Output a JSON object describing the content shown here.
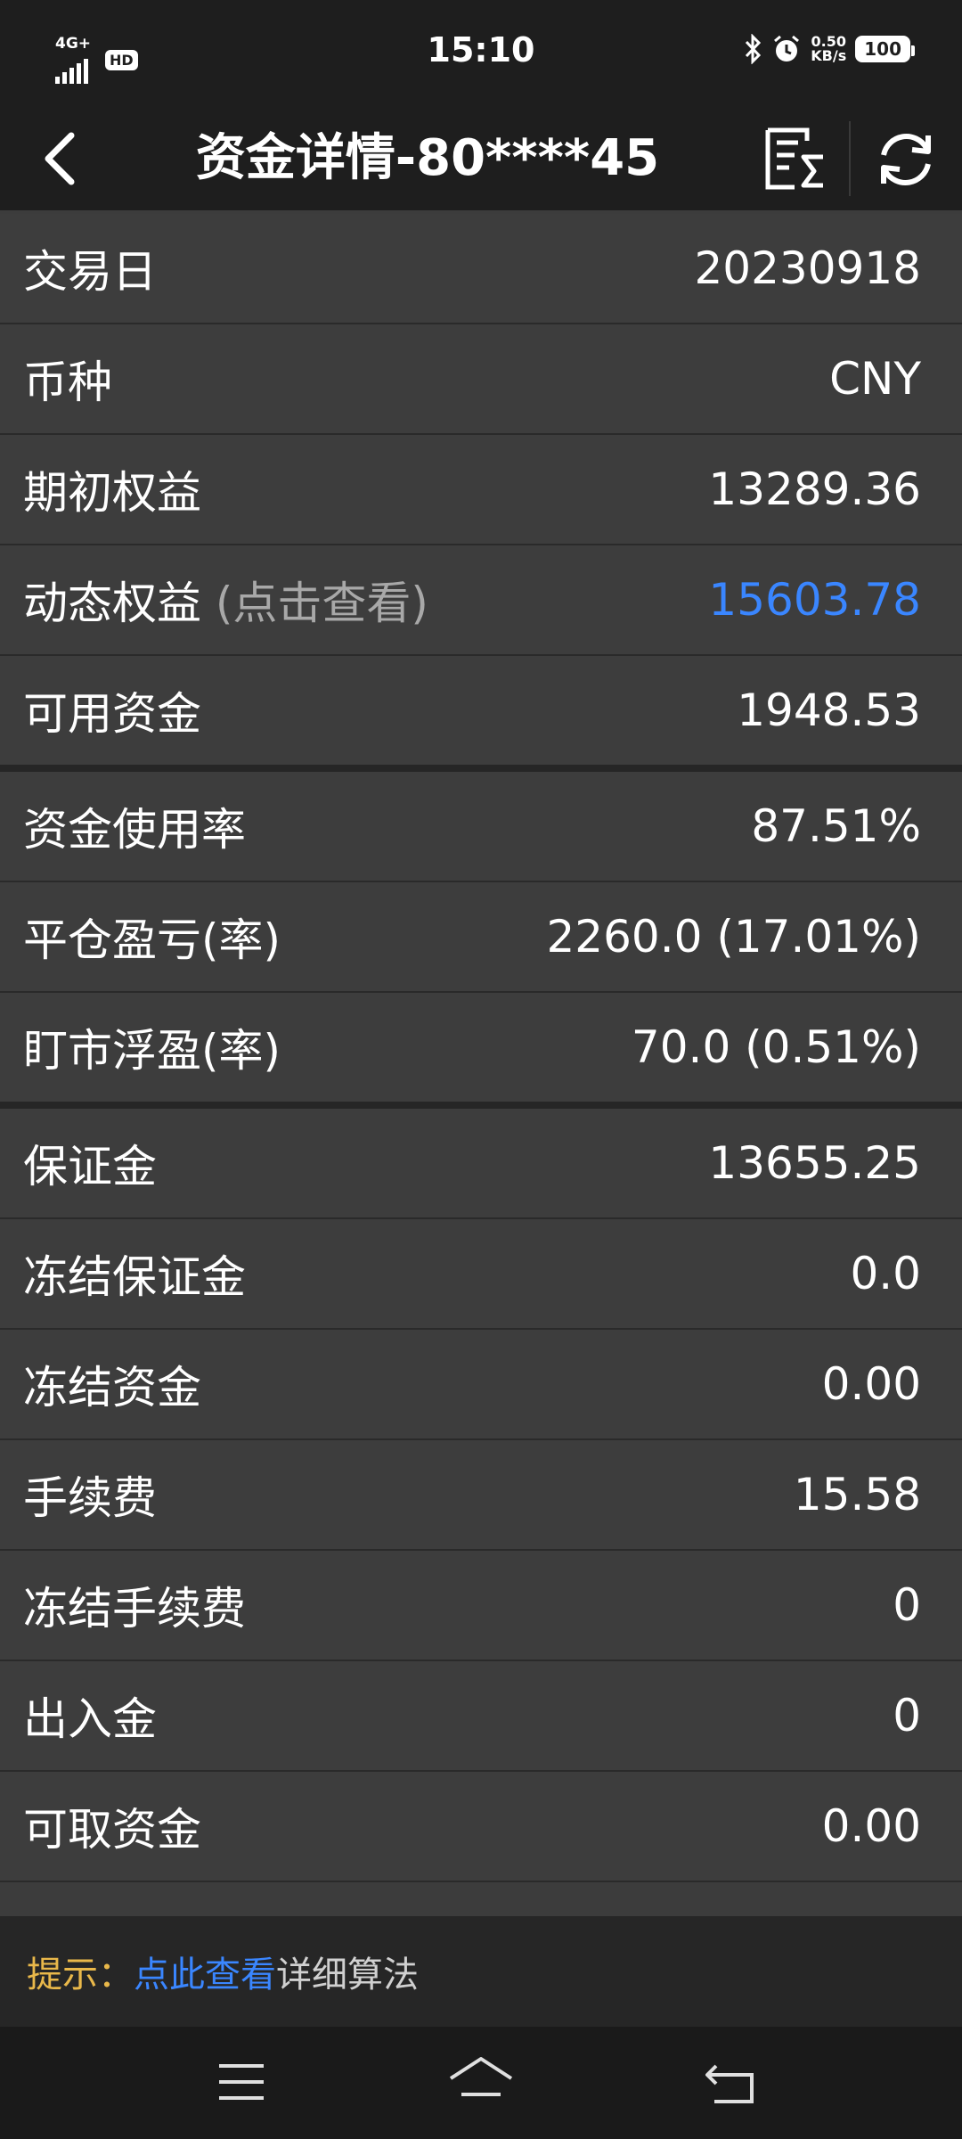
{
  "status_bar": {
    "network": "4G+",
    "hd": "HD",
    "time": "15:10",
    "speed_value": "0.50",
    "speed_unit": "KB/s",
    "battery": "100",
    "icons": [
      "signal-icon",
      "bluetooth-icon",
      "alarm-icon",
      "battery-icon"
    ]
  },
  "header": {
    "title": "资金详情-80****45",
    "icons": [
      "back-icon",
      "calculator-icon",
      "refresh-icon"
    ]
  },
  "rows": [
    {
      "label": "交易日",
      "value": "20230918"
    },
    {
      "label": "币种",
      "value": "CNY"
    },
    {
      "label": "期初权益",
      "value": "13289.36"
    },
    {
      "label": "动态权益",
      "hint": "(点击查看)",
      "value": "15603.78"
    },
    {
      "label": "可用资金",
      "value": "1948.53"
    },
    {
      "label": "资金使用率",
      "value": "87.51%"
    },
    {
      "label": "平仓盈亏(率)",
      "value": "2260.0 (17.01%)"
    },
    {
      "label": "盯市浮盈(率)",
      "value": "70.0 (0.51%)"
    },
    {
      "label": "保证金",
      "value": "13655.25"
    },
    {
      "label": "冻结保证金",
      "value": "0.0"
    },
    {
      "label": "冻结资金",
      "value": "0.00"
    },
    {
      "label": "手续费",
      "value": "15.58"
    },
    {
      "label": "冻结手续费",
      "value": "0"
    },
    {
      "label": "出入金",
      "value": "0"
    },
    {
      "label": "可取资金",
      "value": "0.00"
    }
  ],
  "tip": {
    "label": "提示：",
    "link": "点此查看",
    "rest": "详细算法"
  },
  "colors": {
    "accent_blue": "#3a86ff",
    "tip_label": "#e9b84a",
    "background": "#3c3c3c",
    "bar": "#1e1e1e"
  },
  "nav_bar": {
    "icons": [
      "menu-icon",
      "home-icon",
      "back-nav-icon"
    ]
  }
}
